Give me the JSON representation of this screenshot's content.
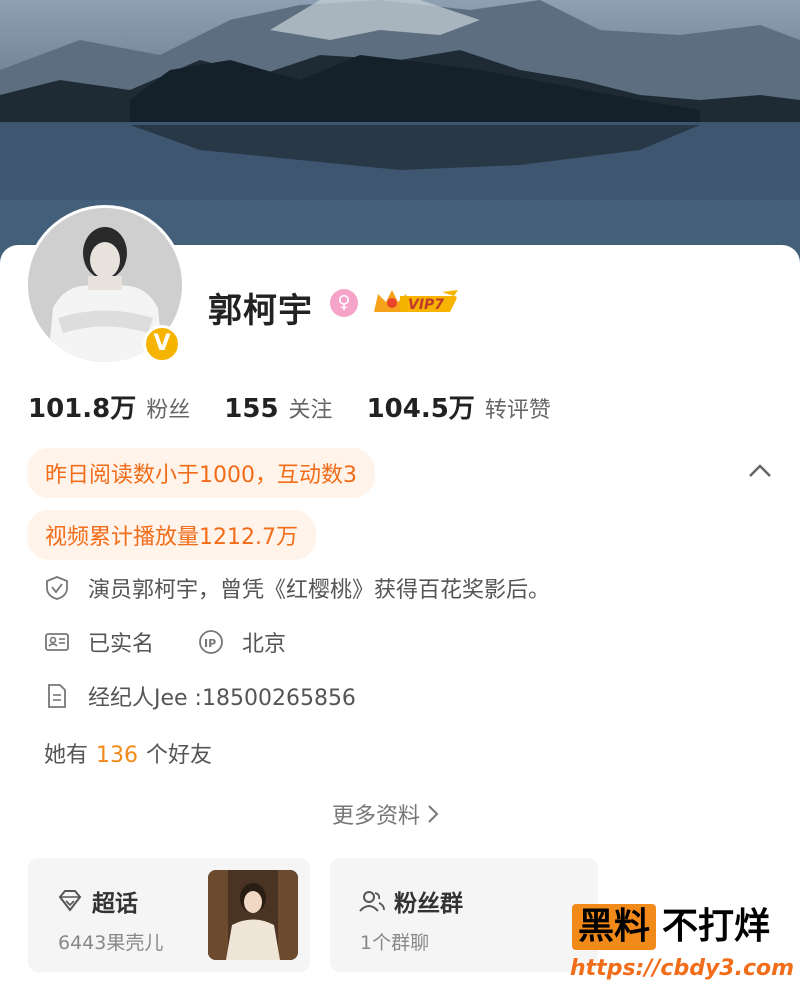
{
  "profile": {
    "name": "郭柯宇",
    "gender_symbol": "♀",
    "vip_label": "VIP7",
    "verified_symbol": "V"
  },
  "stats": [
    {
      "value": "101.8万",
      "label": "粉丝"
    },
    {
      "value": "155",
      "label": "关注"
    },
    {
      "value": "104.5万",
      "label": "转评赞"
    }
  ],
  "pills": {
    "reading": "昨日阅读数小于1000，互动数3",
    "video": "视频累计播放量1212.7万"
  },
  "info": {
    "bio": "演员郭柯宇，曾凭《红樱桃》获得百花奖影后。",
    "real_name": "已实名",
    "ip_label": "北京",
    "agent": "经纪人Jee :18500265856"
  },
  "friends": {
    "prefix": "她有",
    "count": "136",
    "suffix": "个好友"
  },
  "more_link": "更多资料",
  "supertopic": {
    "title": "超话",
    "subtitle": "6443果壳儿"
  },
  "fan_group": {
    "title": "粉丝群",
    "subtitle": "1个群聊"
  },
  "watermark": {
    "badge": "黑料",
    "text": "不打烊",
    "url": "https://cbdy3.com"
  },
  "colors": {
    "accent_orange": "#f26d1a",
    "pill_bg": "#fff3ea",
    "verified_gold": "#f6b400",
    "gender_pink": "#f6a3c9"
  }
}
